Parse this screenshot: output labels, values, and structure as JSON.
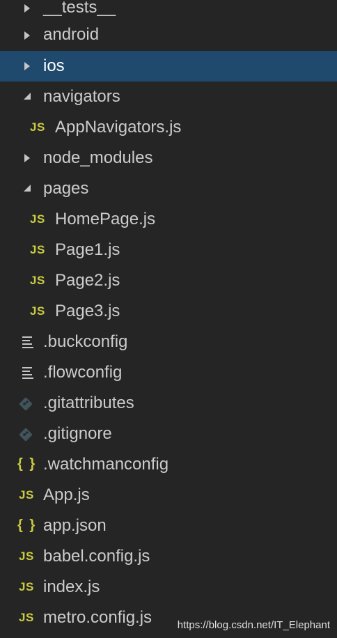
{
  "explorer": {
    "items": [
      {
        "label": "__tests__",
        "kind": "folder",
        "state": "closed"
      },
      {
        "label": "android",
        "kind": "folder",
        "state": "closed"
      },
      {
        "label": "ios",
        "kind": "folder",
        "state": "closed",
        "selected": true
      },
      {
        "label": "navigators",
        "kind": "folder",
        "state": "open"
      },
      {
        "label": "AppNavigators.js",
        "kind": "js",
        "icon": "JS"
      },
      {
        "label": "node_modules",
        "kind": "folder",
        "state": "closed"
      },
      {
        "label": "pages",
        "kind": "folder",
        "state": "open"
      },
      {
        "label": "HomePage.js",
        "kind": "js",
        "icon": "JS"
      },
      {
        "label": "Page1.js",
        "kind": "js",
        "icon": "JS"
      },
      {
        "label": "Page2.js",
        "kind": "js",
        "icon": "JS"
      },
      {
        "label": "Page3.js",
        "kind": "js",
        "icon": "JS"
      },
      {
        "label": ".buckconfig",
        "kind": "config",
        "icon": "lines-icon"
      },
      {
        "label": ".flowconfig",
        "kind": "config",
        "icon": "lines-icon"
      },
      {
        "label": ".gitattributes",
        "kind": "git",
        "icon": "git-icon"
      },
      {
        "label": ".gitignore",
        "kind": "git",
        "icon": "git-icon"
      },
      {
        "label": ".watchmanconfig",
        "kind": "json",
        "icon": "{ }"
      },
      {
        "label": "App.js",
        "kind": "js",
        "icon": "JS"
      },
      {
        "label": "app.json",
        "kind": "json",
        "icon": "{ }"
      },
      {
        "label": "babel.config.js",
        "kind": "js",
        "icon": "JS"
      },
      {
        "label": "index.js",
        "kind": "js",
        "icon": "JS"
      },
      {
        "label": "metro.config.js",
        "kind": "js",
        "icon": "JS"
      }
    ]
  },
  "watermark": "https://blog.csdn.net/IT_Elephant",
  "colors": {
    "background": "#252526",
    "selection": "#1f4a6e",
    "js_icon": "#cbcb41",
    "git_icon": "#41535b",
    "text": "#cccccc"
  }
}
